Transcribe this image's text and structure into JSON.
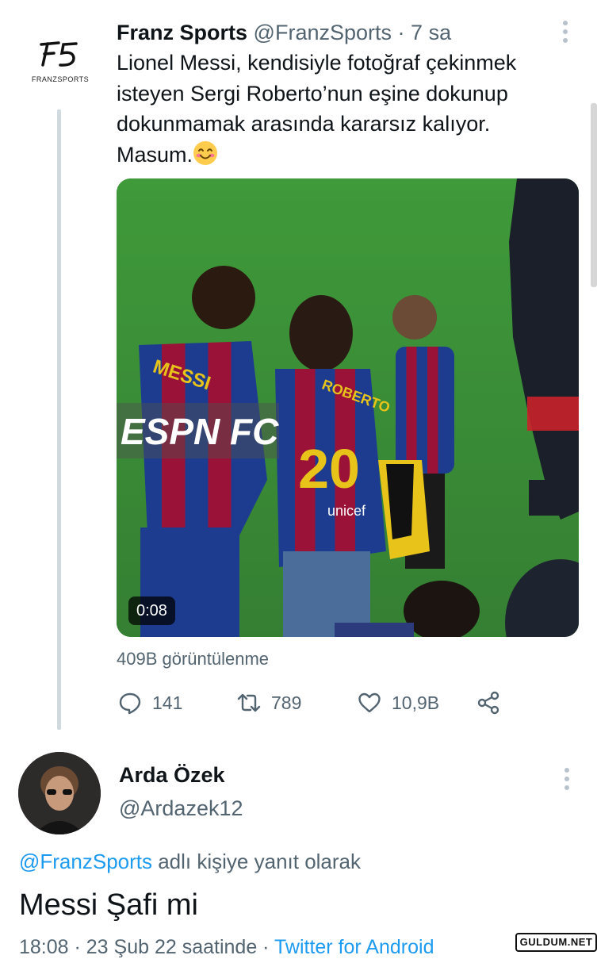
{
  "tweet": {
    "author_name": "Franz Sports",
    "author_handle": "@FranzSports",
    "separator": "·",
    "time": "7 sa",
    "text": "Lionel Messi, kendisiyle fotoğraf çekinmek isteyen Sergi Roberto’nun eşine dokunup dokunmamak arasında kararsız kalıyor. Masum.",
    "emoji": "smiling-face-icon",
    "avatar_logo_text": "FRANZSPORTS",
    "video": {
      "duration": "0:08",
      "overlay_text": "ESPN FC",
      "jersey_name_1": "MESSI",
      "jersey_name_2": "ROBERTO",
      "jersey_number_2": "20",
      "sponsor": "unicef"
    },
    "views": "409B görüntülenme",
    "stats": {
      "replies": "141",
      "retweets": "789",
      "likes": "10,9B"
    }
  },
  "reply": {
    "author_name": "Arda Özek",
    "author_handle": "@Ardazek12",
    "reply_to_handle": "@FranzSports",
    "reply_to_suffix": " adlı kişiye yanıt olarak",
    "text": "Messi Şafi mi",
    "meta_prefix": "18:08 · 23 Şub 22 saatinde · ",
    "source": "Twitter for Android"
  },
  "watermark": "GULDUM.NET",
  "colors": {
    "link": "#1d9bf0",
    "secondary": "#536471",
    "thread_line": "#cfd9de"
  }
}
